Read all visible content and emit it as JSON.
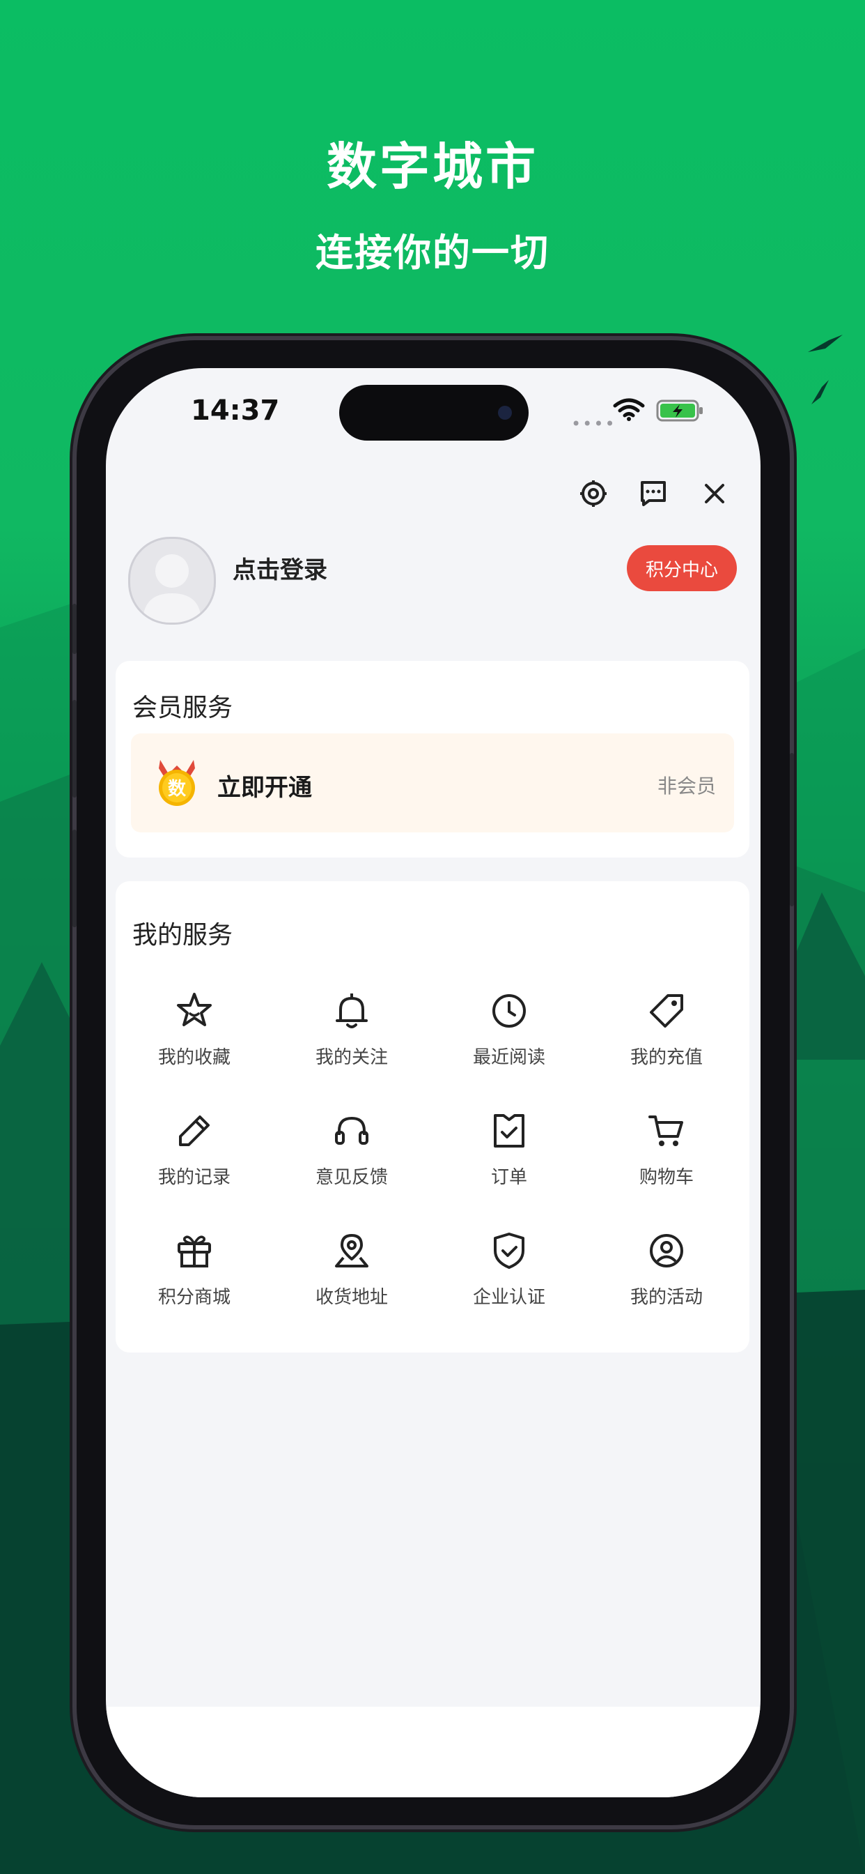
{
  "hero": {
    "title": "数字城市",
    "subtitle": "连接你的一切"
  },
  "status_bar": {
    "time": "14:37"
  },
  "colors": {
    "brand_green": "#0bbd63",
    "points_red": "#ea4a3e",
    "member_bg": "#fff7ee"
  },
  "profile": {
    "login_text": "点击登录",
    "points_button": "积分中心"
  },
  "top_icons": [
    "settings-icon",
    "message-icon",
    "close-icon"
  ],
  "membership": {
    "title": "会员服务",
    "badge_text": "数",
    "action_label": "立即开通",
    "status": "非会员"
  },
  "services": {
    "title": "我的服务",
    "items": [
      {
        "label": "我的收藏",
        "icon": "star-icon"
      },
      {
        "label": "我的关注",
        "icon": "bell-icon"
      },
      {
        "label": "最近阅读",
        "icon": "clock-icon"
      },
      {
        "label": "我的充值",
        "icon": "tag-icon"
      },
      {
        "label": "我的记录",
        "icon": "pencil-icon"
      },
      {
        "label": "意见反馈",
        "icon": "headset-icon"
      },
      {
        "label": "订单",
        "icon": "order-icon"
      },
      {
        "label": "购物车",
        "icon": "cart-icon"
      },
      {
        "label": "积分商城",
        "icon": "gift-icon"
      },
      {
        "label": "收货地址",
        "icon": "location-icon"
      },
      {
        "label": "企业认证",
        "icon": "shield-icon"
      },
      {
        "label": "我的活动",
        "icon": "user-circle-icon"
      }
    ]
  }
}
